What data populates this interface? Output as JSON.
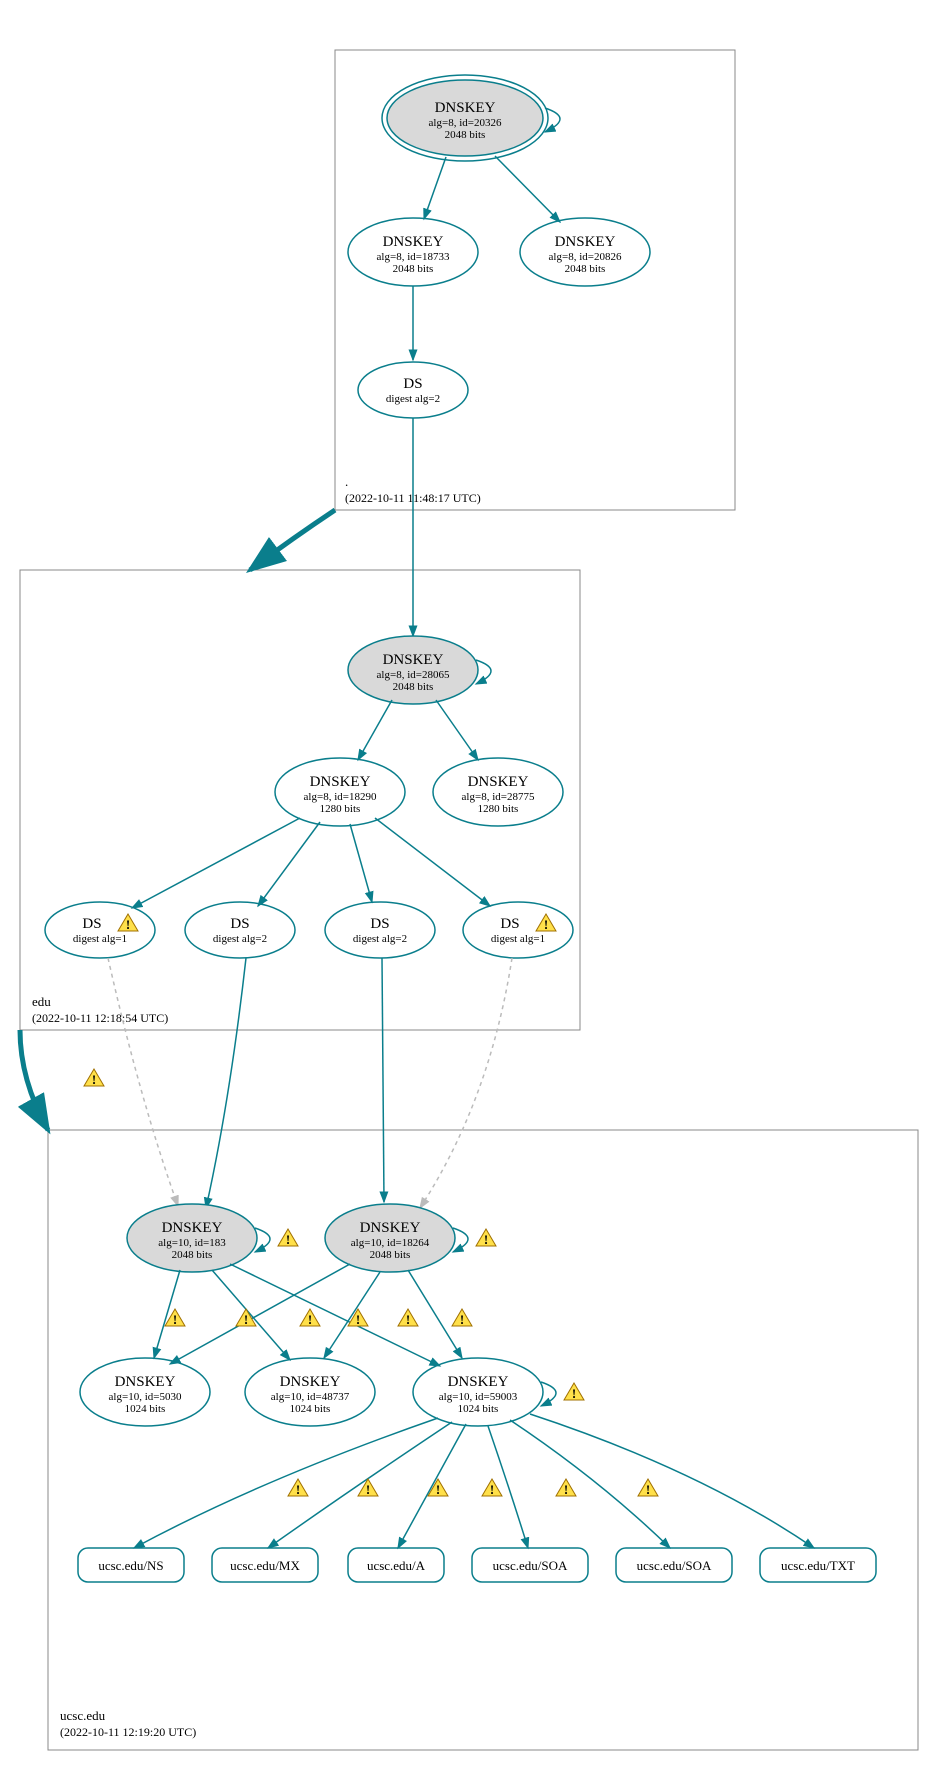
{
  "zones": {
    "root": {
      "name": ".",
      "timestamp": "(2022-10-11 11:48:17 UTC)"
    },
    "edu": {
      "name": "edu",
      "timestamp": "(2022-10-11 12:18:54 UTC)"
    },
    "ucsc": {
      "name": "ucsc.edu",
      "timestamp": "(2022-10-11 12:19:20 UTC)"
    }
  },
  "nodes": {
    "root_ksk": {
      "title": "DNSKEY",
      "line1": "alg=8, id=20326",
      "line2": "2048 bits"
    },
    "root_zsk1": {
      "title": "DNSKEY",
      "line1": "alg=8, id=18733",
      "line2": "2048 bits"
    },
    "root_zsk2": {
      "title": "DNSKEY",
      "line1": "alg=8, id=20826",
      "line2": "2048 bits"
    },
    "root_ds": {
      "title": "DS",
      "line1": "digest alg=2",
      "line2": ""
    },
    "edu_ksk": {
      "title": "DNSKEY",
      "line1": "alg=8, id=28065",
      "line2": "2048 bits"
    },
    "edu_zsk1": {
      "title": "DNSKEY",
      "line1": "alg=8, id=18290",
      "line2": "1280 bits"
    },
    "edu_zsk2": {
      "title": "DNSKEY",
      "line1": "alg=8, id=28775",
      "line2": "1280 bits"
    },
    "edu_ds1": {
      "title": "DS",
      "line1": "digest alg=1",
      "line2": ""
    },
    "edu_ds2": {
      "title": "DS",
      "line1": "digest alg=2",
      "line2": ""
    },
    "edu_ds3": {
      "title": "DS",
      "line1": "digest alg=2",
      "line2": ""
    },
    "edu_ds4": {
      "title": "DS",
      "line1": "digest alg=1",
      "line2": ""
    },
    "ucsc_ksk1": {
      "title": "DNSKEY",
      "line1": "alg=10, id=183",
      "line2": "2048 bits"
    },
    "ucsc_ksk2": {
      "title": "DNSKEY",
      "line1": "alg=10, id=18264",
      "line2": "2048 bits"
    },
    "ucsc_zsk1": {
      "title": "DNSKEY",
      "line1": "alg=10, id=5030",
      "line2": "1024 bits"
    },
    "ucsc_zsk2": {
      "title": "DNSKEY",
      "line1": "alg=10, id=48737",
      "line2": "1024 bits"
    },
    "ucsc_zsk3": {
      "title": "DNSKEY",
      "line1": "alg=10, id=59003",
      "line2": "1024 bits"
    }
  },
  "records": {
    "r1": "ucsc.edu/NS",
    "r2": "ucsc.edu/MX",
    "r3": "ucsc.edu/A",
    "r4": "ucsc.edu/SOA",
    "r5": "ucsc.edu/SOA",
    "r6": "ucsc.edu/TXT"
  }
}
